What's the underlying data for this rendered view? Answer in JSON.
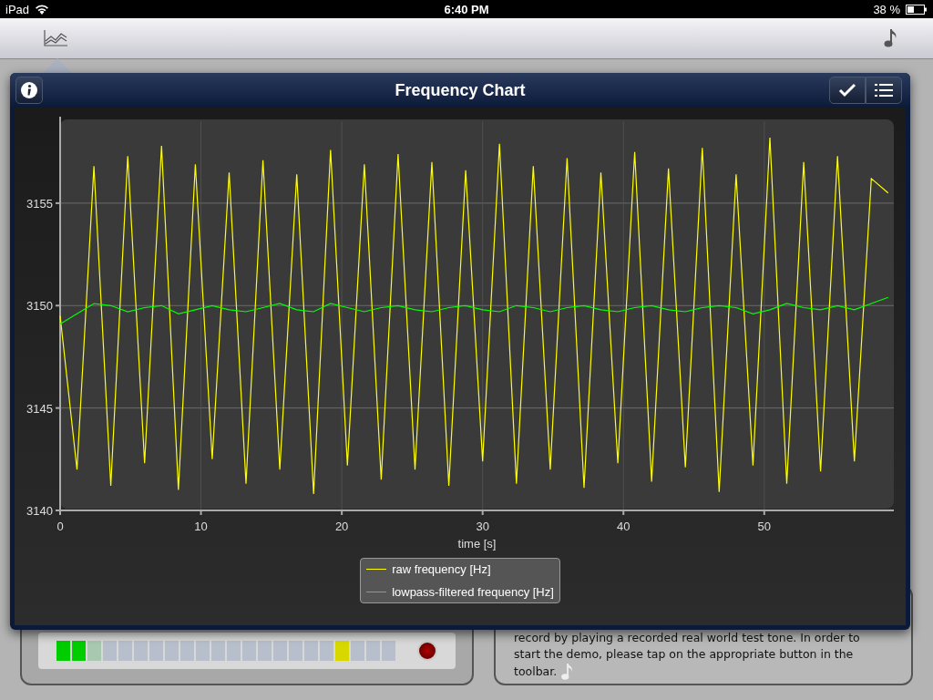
{
  "status_bar": {
    "device": "iPad",
    "time": "6:40 PM",
    "battery": "38 %"
  },
  "popover": {
    "title": "Frequency Chart",
    "chart_data": {
      "type": "line",
      "grid": true,
      "xlabel": "time [s]",
      "xlim": [
        0,
        59.2
      ],
      "ylim": [
        3140,
        3159
      ],
      "xticks": [
        0,
        10,
        20,
        30,
        40,
        50
      ],
      "yticks": [
        3140,
        3145,
        3150,
        3155
      ],
      "x": [
        0,
        1.2,
        2.4,
        3.6,
        4.8,
        6,
        7.2,
        8.4,
        9.6,
        10.8,
        12,
        13.2,
        14.4,
        15.6,
        16.8,
        18,
        19.2,
        20.4,
        21.6,
        22.8,
        24,
        25.2,
        26.4,
        27.6,
        28.8,
        30,
        31.2,
        32.4,
        33.6,
        34.8,
        36,
        37.2,
        38.4,
        39.6,
        40.8,
        42,
        43.2,
        44.4,
        45.6,
        46.8,
        48,
        49.2,
        50.4,
        51.6,
        52.8,
        54,
        55.2,
        56.4,
        57.6,
        58.8
      ],
      "series": [
        {
          "name": "raw frequency [Hz]",
          "color": "#ffff00",
          "values": [
            3149.5,
            3142,
            3156.8,
            3141.2,
            3157.3,
            3142.3,
            3157.8,
            3141,
            3156.9,
            3142.5,
            3156.5,
            3141.3,
            3157.1,
            3142,
            3156.4,
            3140.8,
            3157.6,
            3142.2,
            3156.9,
            3141.5,
            3157.4,
            3142,
            3157.0,
            3141.2,
            3156.6,
            3142.4,
            3157.9,
            3141.3,
            3156.8,
            3142,
            3157.2,
            3141.1,
            3156.5,
            3142.3,
            3157.5,
            3141.4,
            3156.7,
            3142.1,
            3157.7,
            3140.9,
            3156.4,
            3142.2,
            3158.2,
            3141.3,
            3157.0,
            3141.9,
            3157.3,
            3142.4,
            3156.2,
            3155.5
          ]
        },
        {
          "name": "lowpass-filtered frequency [Hz]",
          "color": "#00ff00",
          "values": [
            3149.1,
            3149.6,
            3150.1,
            3150.0,
            3149.7,
            3149.9,
            3150.0,
            3149.6,
            3149.8,
            3150.0,
            3149.8,
            3149.7,
            3149.9,
            3150.1,
            3149.8,
            3149.7,
            3150.1,
            3149.9,
            3149.7,
            3149.9,
            3150.0,
            3149.8,
            3149.7,
            3149.9,
            3150.0,
            3149.8,
            3149.7,
            3150.0,
            3149.9,
            3149.7,
            3149.9,
            3150.0,
            3149.8,
            3149.7,
            3149.9,
            3150.0,
            3149.8,
            3149.7,
            3149.9,
            3150.0,
            3149.9,
            3149.6,
            3149.8,
            3150.1,
            3149.9,
            3149.8,
            3150.0,
            3149.8,
            3150.1,
            3150.4
          ]
        }
      ]
    }
  },
  "meter": {
    "cells": [
      {
        "color": "#00cc00"
      },
      {
        "color": "#00cc00"
      },
      {
        "color": "#a8c8b0"
      },
      {
        "color": "#b8bfcc"
      },
      {
        "color": "#b8bfcc"
      },
      {
        "color": "#b8bfcc"
      },
      {
        "color": "#b8bfcc"
      },
      {
        "color": "#b8bfcc"
      },
      {
        "color": "#b8bfcc"
      },
      {
        "color": "#b8bfcc"
      },
      {
        "color": "#b8bfcc"
      },
      {
        "color": "#b8bfcc"
      },
      {
        "color": "#b8bfcc"
      },
      {
        "color": "#b8bfcc"
      },
      {
        "color": "#b8bfcc"
      },
      {
        "color": "#b8bfcc"
      },
      {
        "color": "#b8bfcc"
      },
      {
        "color": "#b8bfcc"
      },
      {
        "color": "#d8d800"
      },
      {
        "color": "#b8bfcc"
      },
      {
        "color": "#b8bfcc"
      },
      {
        "color": "#b8bfcc"
      }
    ]
  },
  "help_text": "record by playing a recorded real world test tone. In order to start the demo, please tap on the appropriate button in the toolbar."
}
